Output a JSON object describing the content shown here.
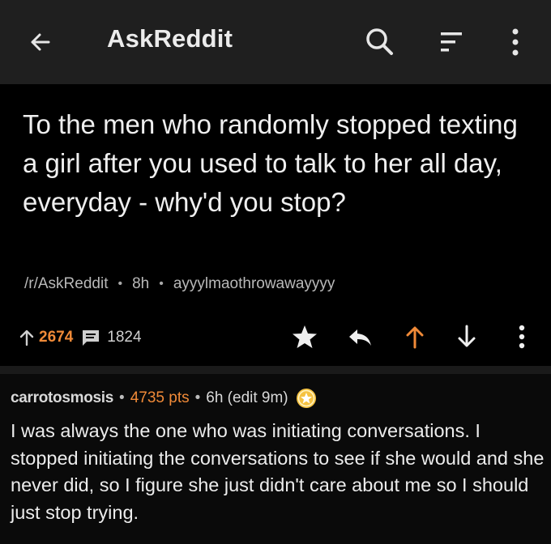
{
  "header": {
    "title": "AskReddit",
    "back_icon": "arrow-left-icon",
    "search_icon": "search-icon",
    "sort_icon": "sort-icon",
    "more_icon": "more-vertical-icon"
  },
  "post": {
    "title": "To the men who randomly stopped texting a girl after you used to talk to her all day, everyday - why'd you stop?",
    "subreddit": "/r/AskReddit",
    "age": "8h",
    "author": "ayyylmaothrowawayyyy",
    "score": "2674",
    "comment_count": "1824"
  },
  "actions": [
    "star-icon",
    "reply-icon",
    "upvote-icon",
    "downvote-icon",
    "more-vertical-icon"
  ],
  "comment": {
    "author": "carrotosmosis",
    "points": "4735 pts",
    "age": "6h (edit 9m)",
    "body": "I was always the one who was initiating conversations. I stopped initiating the conversations to see if she would and she never did, so I figure she just didn't care about me so I should just stop trying."
  },
  "colors": {
    "accent": "#f08a38",
    "topbar": "#1f1f1f",
    "background": "#000000",
    "gold": "#f5c242"
  }
}
